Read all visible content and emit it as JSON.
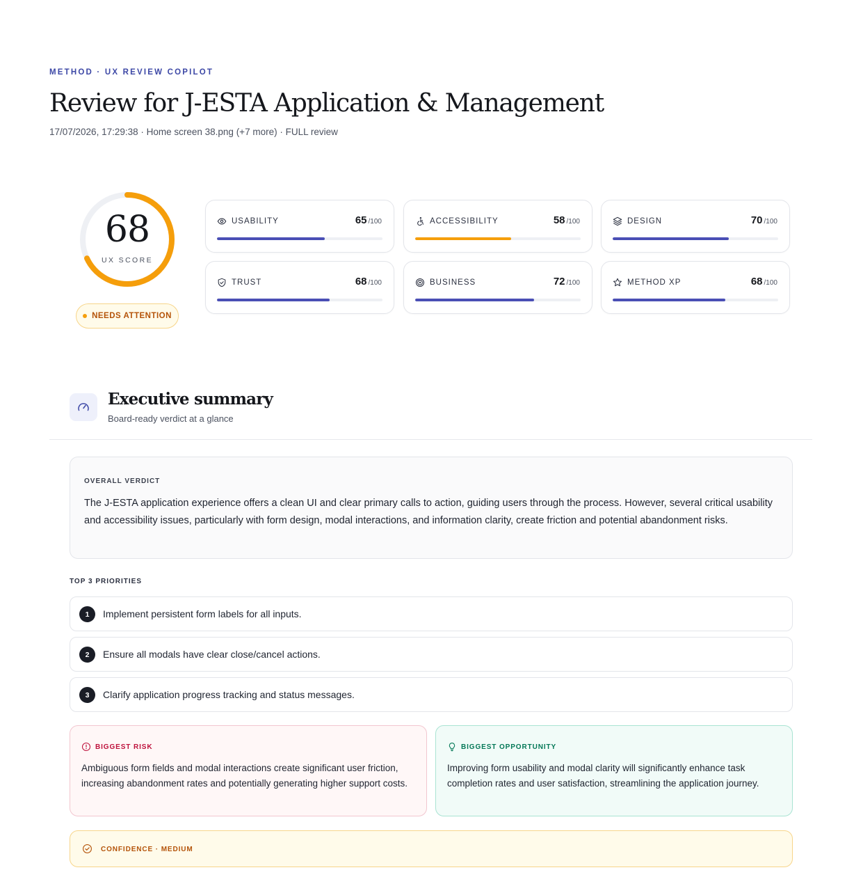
{
  "header": {
    "eyebrow": "METHOD · UX REVIEW COPILOT",
    "title": "Review for J-ESTA Application & Management",
    "meta": "17/07/2026, 17:29:38 · Home screen 38.png (+7 more) · FULL review"
  },
  "ux_score": {
    "value": "68",
    "label": "UX SCORE",
    "fraction": 0.68,
    "color": "#f59e0b",
    "status": "NEEDS ATTENTION"
  },
  "metrics": [
    {
      "label": "USABILITY",
      "score": "65",
      "max": "/100",
      "fraction": 0.65,
      "color": "#4a4fb5",
      "icon": "eye-icon"
    },
    {
      "label": "ACCESSIBILITY",
      "score": "58",
      "max": "/100",
      "fraction": 0.58,
      "color": "#f59e0b",
      "icon": "accessibility-icon"
    },
    {
      "label": "DESIGN",
      "score": "70",
      "max": "/100",
      "fraction": 0.7,
      "color": "#4a4fb5",
      "icon": "layers-icon"
    },
    {
      "label": "TRUST",
      "score": "68",
      "max": "/100",
      "fraction": 0.68,
      "color": "#4a4fb5",
      "icon": "shield-icon"
    },
    {
      "label": "BUSINESS",
      "score": "72",
      "max": "/100",
      "fraction": 0.72,
      "color": "#4a4fb5",
      "icon": "target-icon"
    },
    {
      "label": "METHOD XP",
      "score": "68",
      "max": "/100",
      "fraction": 0.68,
      "color": "#4a4fb5",
      "icon": "star-icon"
    }
  ],
  "summary": {
    "title": "Executive summary",
    "subtitle": "Board-ready verdict at a glance",
    "icon": "gauge-icon",
    "verdict_label": "OVERALL VERDICT",
    "verdict_text": "The J-ESTA application experience offers a clean UI and clear primary calls to action, guiding users through the process. However, several critical usability and accessibility issues, particularly with form design, modal interactions, and information clarity, create friction and potential abandonment risks.",
    "priorities_label": "TOP 3 PRIORITIES",
    "priorities": [
      {
        "num": "1",
        "text": "Implement persistent form labels for all inputs."
      },
      {
        "num": "2",
        "text": "Ensure all modals have clear close/cancel actions."
      },
      {
        "num": "3",
        "text": "Clarify application progress tracking and status messages."
      }
    ],
    "risk": {
      "label": "BIGGEST RISK",
      "icon": "alert-circle-icon",
      "text": "Ambiguous form fields and modal interactions create significant user friction, increasing abandonment rates and potentially generating higher support costs."
    },
    "opportunity": {
      "label": "BIGGEST OPPORTUNITY",
      "icon": "lightbulb-icon",
      "text": "Improving form usability and modal clarity will significantly enhance task completion rates and user satisfaction, streamlining the application journey."
    },
    "confidence": {
      "label": "CONFIDENCE · MEDIUM",
      "icon": "check-circle-icon"
    }
  }
}
